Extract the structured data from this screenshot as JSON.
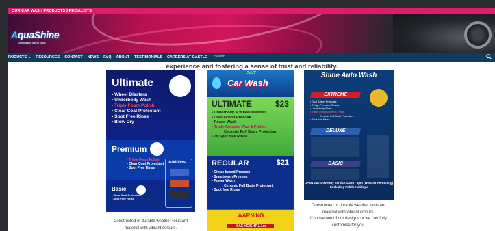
{
  "topbar": {
    "text": "OUR CAR WASH PRODUCTS SPECIALISTS"
  },
  "brand": {
    "logo_a": "A",
    "logo_rest": "quaShine",
    "tagline": "EXPERIENCE STAYS HERE"
  },
  "nav": {
    "items": [
      "RODUCTS ⌄",
      "RESOURCES",
      "CONTACT",
      "NEWS",
      "FAQ",
      "ABOUT",
      "TESTIMONIALS",
      "CAREERS AT CASTLE"
    ],
    "search_placeholder": "Search..."
  },
  "intro": {
    "line1": "experience and fostering a sense of trust and reliability."
  },
  "flyer1": {
    "ultimate": "Ultimate",
    "ult_items": [
      "• Wheel Blasters",
      "• Underbody Wash",
      "• Triple Foam Polish",
      "• Clear Coat Protectant",
      "• Spot Free Rinse",
      "• Blow Dry"
    ],
    "premium": "Premium",
    "prem_items": [
      "• Triple Foam Polish",
      "• Clear Coat Protectant",
      "• Spot Free Rinse"
    ],
    "basic": "Basic",
    "basic_items": [
      "• Clear Coat Protectant",
      "• Spot Free Rinse"
    ],
    "addons": "Add Ons"
  },
  "flyer2": {
    "brand": "Car Wash",
    "brand_top": "24/7",
    "ultimate": "ULTIMATE",
    "ult_price": "$23",
    "ult_items": [
      "• Underbody & Wheel Blasters",
      "• Dual Action Presoak",
      "• Power Wash",
      "• Triple Ceramic Wax & Polish",
      "Ceramic Full Body Protectant",
      "• 2x Spot free Rinse"
    ],
    "regular": "REGULAR",
    "reg_price": "$21",
    "reg_items": [
      "• Citrus based Presoak",
      "• Smartwash Presoak",
      "• Power Wash",
      "Ceramic Full Body Protectant",
      "• Spot free Rinse"
    ],
    "warning": "WARNING",
    "max_height": "MAX HEIGHT 2.1m"
  },
  "flyer3": {
    "title": "Shine Auto Wash",
    "extreme": "EXTREME",
    "ext_items": [
      "• Dual Action Presoaks",
      "• 2 High Pressure Rinses",
      "• Underbody Wash",
      "• Triple Ceramic Wax & Polish",
      "Ceramic Full Body Protectant",
      "• Spot free Rinse"
    ],
    "deluxe": "DELUXE",
    "basic": "BASIC",
    "open": "OPEN 24/7 Driveway Service 10am - 3pm (Weather Permitting) Excluding Public Holidays"
  },
  "captions": {
    "c1_line1": "Constructed of durable weather resistant",
    "c1_line2": "material with vibrant colours.",
    "c3_line1": "Constructed of durable weather resistant",
    "c3_line2": "material with vibrant colours.",
    "c3_line3": "Choose one of our designs or we can fully",
    "c3_line4": "customise for you."
  },
  "colors": {
    "accent": "#e01b6b",
    "nav": "#123a5c"
  }
}
